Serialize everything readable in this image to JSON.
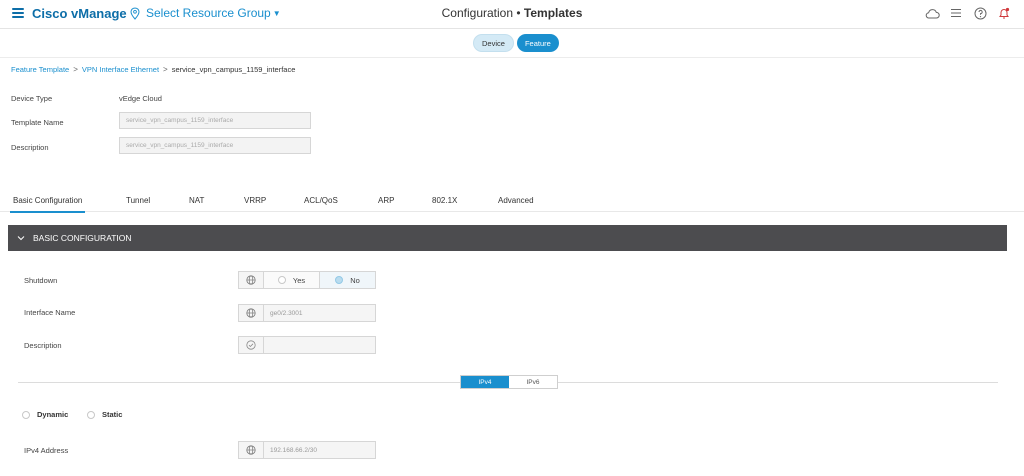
{
  "header": {
    "brand": "Cisco vManage",
    "resource_group": "Select Resource Group",
    "title_prefix": "Configuration",
    "title_separator": "•",
    "title_main": "Templates"
  },
  "toggle": {
    "device": "Device",
    "feature": "Feature",
    "selected": "Feature"
  },
  "breadcrumb": {
    "items": [
      "Feature Template",
      "VPN Interface Ethernet"
    ],
    "current": "service_vpn_campus_1159_interface"
  },
  "info": {
    "device_type_label": "Device Type",
    "device_type_value": "vEdge Cloud",
    "template_name_label": "Template Name",
    "template_name_value": "service_vpn_campus_1159_interface",
    "description_label": "Description",
    "description_value": "service_vpn_campus_1159_interface"
  },
  "tabs": [
    "Basic Configuration",
    "Tunnel",
    "NAT",
    "VRRP",
    "ACL/QoS",
    "ARP",
    "802.1X",
    "Advanced"
  ],
  "section": {
    "title": "BASIC CONFIGURATION"
  },
  "fields": {
    "shutdown_label": "Shutdown",
    "shutdown_yes": "Yes",
    "shutdown_no": "No",
    "shutdown_selected": "No",
    "interface_name_label": "Interface Name",
    "interface_name_value": "ge0/2.3001",
    "description_label": "Description",
    "description_value": ""
  },
  "ip_toggle": {
    "ipv4": "IPv4",
    "ipv6": "IPv6",
    "selected": "IPv4"
  },
  "address_mode": {
    "dynamic": "Dynamic",
    "static": "Static"
  },
  "ipv4": {
    "address_label": "IPv4 Address",
    "address_value": "192.168.66.2/30"
  },
  "colors": {
    "accent": "#1a8fce",
    "brand": "#0d6ea8",
    "section_header": "#4c4c4f"
  }
}
